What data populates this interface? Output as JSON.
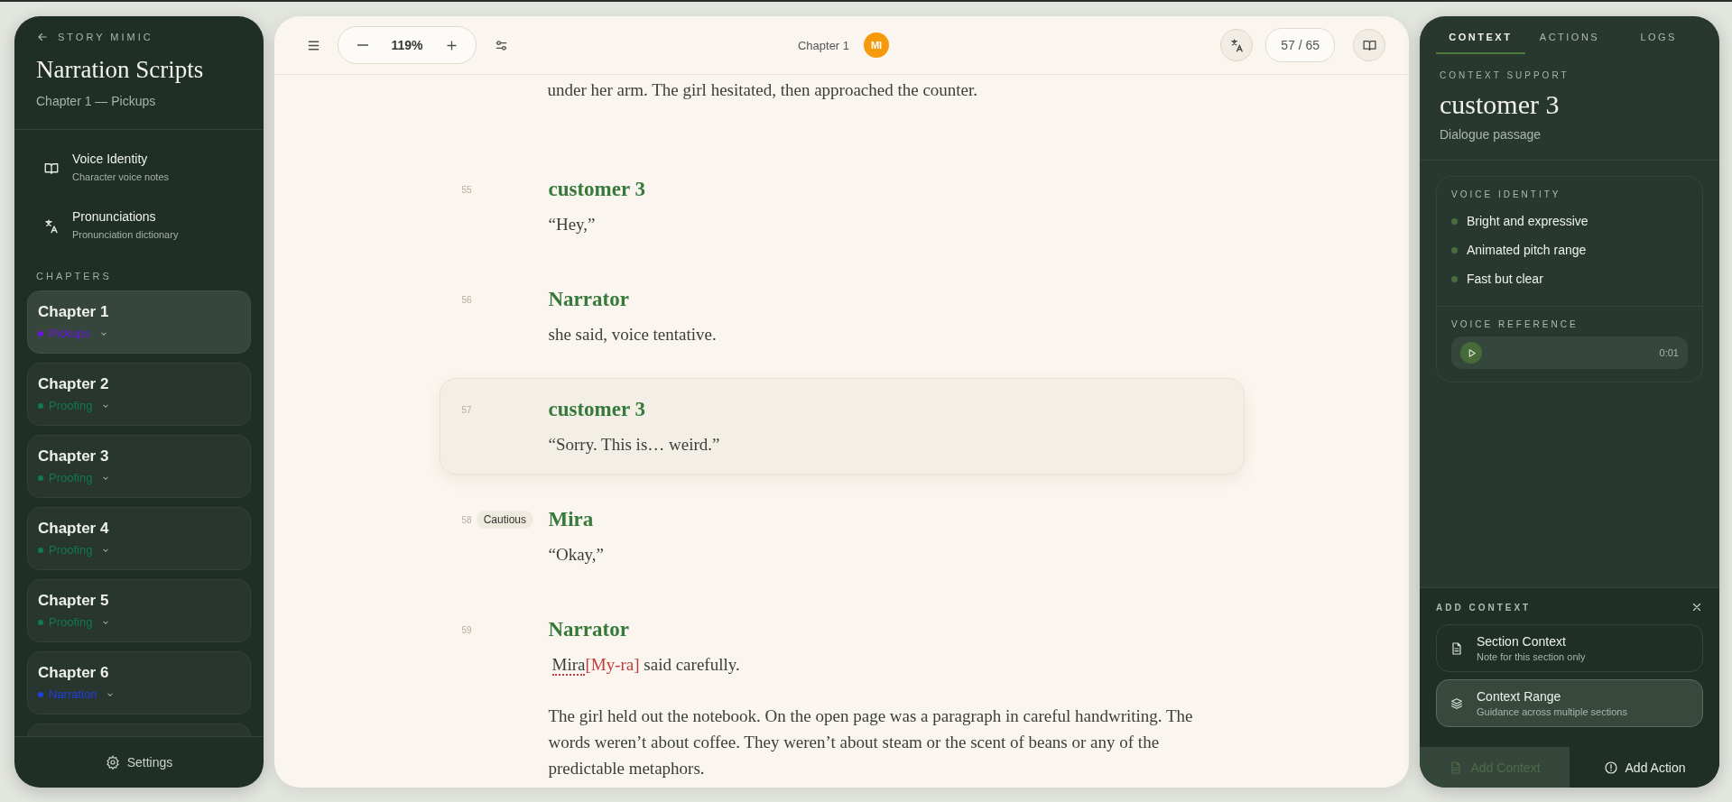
{
  "sidebar": {
    "back_label": "STORY MIMIC",
    "title": "Narration Scripts",
    "subtitle": "Chapter 1 — Pickups",
    "tools": [
      {
        "kind": "book",
        "label": "Voice Identity",
        "description": "Character voice notes"
      },
      {
        "kind": "translate",
        "label": "Pronunciations",
        "description": "Pronunciation dictionary"
      }
    ],
    "chapters_heading": "CHAPTERS",
    "chapters": [
      {
        "title": "Chapter 1",
        "status": "Pickups",
        "color": "#6b14e6",
        "selected": true
      },
      {
        "title": "Chapter 2",
        "status": "Proofing",
        "color": "#0f7a4c",
        "selected": false
      },
      {
        "title": "Chapter 3",
        "status": "Proofing",
        "color": "#0f7a4c",
        "selected": false
      },
      {
        "title": "Chapter 4",
        "status": "Proofing",
        "color": "#0f7a4c",
        "selected": false
      },
      {
        "title": "Chapter 5",
        "status": "Proofing",
        "color": "#0f7a4c",
        "selected": false
      },
      {
        "title": "Chapter 6",
        "status": "Narration",
        "color": "#1f3fe0",
        "selected": false
      }
    ],
    "settings": "Settings"
  },
  "toolbar": {
    "zoom": "119%",
    "chapter": "Chapter 1",
    "avatar": "MI",
    "page": "57 / 65"
  },
  "script": {
    "intro": "under her arm. The girl hesitated, then approached the counter.",
    "sections": [
      {
        "number": "55",
        "speaker": "customer 3",
        "selected": false,
        "paragraphs": [
          {
            "kind": "text",
            "text": "“Hey,”"
          }
        ]
      },
      {
        "number": "56",
        "speaker": "Narrator",
        "selected": false,
        "paragraphs": [
          {
            "kind": "text",
            "text": "she said, voice tentative."
          }
        ]
      },
      {
        "number": "57",
        "speaker": "customer 3",
        "selected": true,
        "paragraphs": [
          {
            "kind": "text",
            "text": "“Sorry. This is… weird.”"
          }
        ]
      },
      {
        "number": "58",
        "speaker": "Mira",
        "tag": "Cautious",
        "selected": false,
        "paragraphs": [
          {
            "kind": "text",
            "text": "“Okay,”"
          }
        ]
      },
      {
        "number": "59",
        "speaker": "Narrator",
        "selected": false,
        "paragraphs": [
          {
            "kind": "pronounced",
            "word": "Mira",
            "respelling": "[My-ra]",
            "rest": " said carefully."
          },
          {
            "kind": "text",
            "text": "The girl held out the notebook. On the open page was a paragraph in careful handwriting. The words weren’t about coffee. They weren’t about steam or the scent of beans or any of the predictable metaphors."
          }
        ]
      }
    ]
  },
  "panel": {
    "tabs": [
      {
        "label": "CONTEXT",
        "selected": true
      },
      {
        "label": "ACTIONS",
        "selected": false
      },
      {
        "label": "LOGS",
        "selected": false
      }
    ],
    "eyebrow": "CONTEXT SUPPORT",
    "title": "customer 3",
    "subtitle": "Dialogue passage",
    "voice_identity": {
      "heading": "VOICE IDENTITY",
      "traits": [
        "Bright and expressive",
        "Animated pitch range",
        "Fast but clear"
      ]
    },
    "voice_reference": {
      "heading": "VOICE REFERENCE",
      "time": "0:01"
    },
    "add_context": {
      "heading": "ADD CONTEXT",
      "options": [
        {
          "kind": "document",
          "title": "Section Context",
          "description": "Note for this section only",
          "selected": false
        },
        {
          "kind": "layers",
          "title": "Context Range",
          "description": "Guidance across multiple sections",
          "selected": true
        }
      ]
    },
    "footer": [
      {
        "kind": "document",
        "label": "Add Context",
        "disabled": true
      },
      {
        "kind": "alert",
        "label": "Add Action",
        "disabled": false
      }
    ]
  }
}
